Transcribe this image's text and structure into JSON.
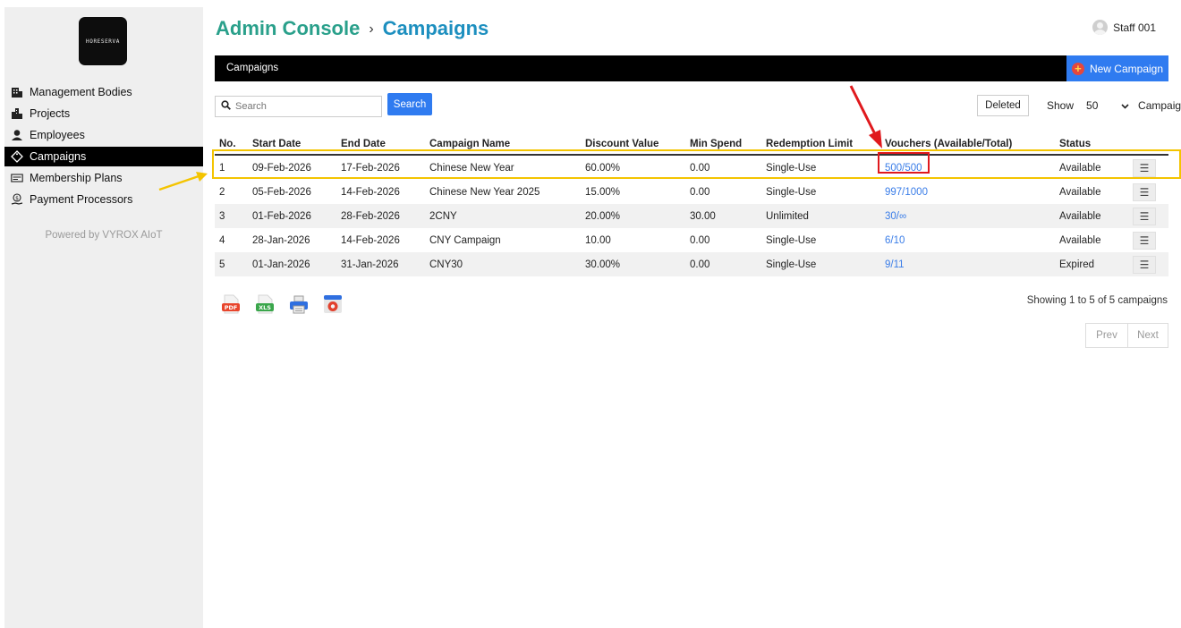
{
  "sidebar": {
    "logo_text": "HORESERVA",
    "items": [
      {
        "label": "Management Bodies",
        "icon": "building-icon"
      },
      {
        "label": "Projects",
        "icon": "city-icon"
      },
      {
        "label": "Employees",
        "icon": "employee-icon"
      },
      {
        "label": "Campaigns",
        "icon": "tag-icon",
        "active": true
      },
      {
        "label": "Membership Plans",
        "icon": "card-icon"
      },
      {
        "label": "Payment Processors",
        "icon": "money-hand-icon"
      }
    ],
    "powered_by": "Powered by VYROX AIoT"
  },
  "header": {
    "title": "Admin Console",
    "crumb": "Campaigns",
    "user": "Staff 001"
  },
  "bar": {
    "label": "Campaigns",
    "new_button": "New Campaign"
  },
  "toolbar": {
    "search_placeholder": "Search",
    "search_button": "Search",
    "deleted_button": "Deleted",
    "show_label": "Show",
    "show_value": "50",
    "show_suffix": "Campaign"
  },
  "table": {
    "columns": [
      "No.",
      "Start Date",
      "End Date",
      "Campaign Name",
      "Discount Value",
      "Min Spend",
      "Redemption Limit",
      "Vouchers (Available/Total)",
      "Status"
    ],
    "rows": [
      [
        "1",
        "09-Feb-2026",
        "17-Feb-2026",
        "Chinese New Year",
        "60.00%",
        "0.00",
        "Single-Use",
        "500/500",
        "Available"
      ],
      [
        "2",
        "05-Feb-2026",
        "14-Feb-2026",
        "Chinese New Year 2025",
        "15.00%",
        "0.00",
        "Single-Use",
        "997/1000",
        "Available"
      ],
      [
        "3",
        "01-Feb-2026",
        "28-Feb-2026",
        "2CNY",
        "20.00%",
        "30.00",
        "Unlimited",
        "30/∞",
        "Available"
      ],
      [
        "4",
        "28-Jan-2026",
        "14-Feb-2026",
        "CNY Campaign",
        "10.00",
        "0.00",
        "Single-Use",
        "6/10",
        "Available"
      ],
      [
        "5",
        "01-Jan-2026",
        "31-Jan-2026",
        "CNY30",
        "30.00%",
        "0.00",
        "Single-Use",
        "9/11",
        "Expired"
      ]
    ],
    "row_menu_glyph": "☰"
  },
  "export": {
    "pdf_label": "PDF",
    "xls_label": "XLS"
  },
  "footer": {
    "showing": "Showing 1 to 5 of 5 campaigns",
    "prev": "Prev",
    "next": "Next"
  },
  "colors": {
    "title_green": "#2aa08b",
    "crumb_blue": "#1d8fbf",
    "primary_blue": "#2f7bf0",
    "highlight_yellow": "#f4c400",
    "highlight_red": "#e0191d"
  }
}
